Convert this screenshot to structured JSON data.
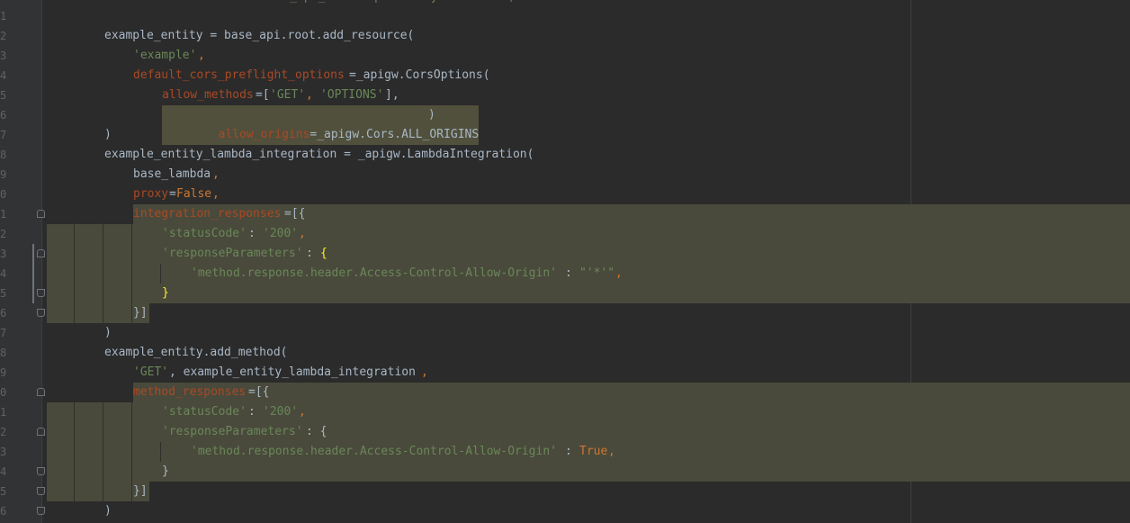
{
  "editor": {
    "top_partial_line": "      root_api_name='ApiGatewayRIServers')",
    "line_numbers": [
      "1",
      "2",
      "3",
      "4",
      "5",
      "6",
      "7",
      "8",
      "9",
      "0",
      "1",
      "2",
      "3",
      "4",
      "5",
      "6",
      "7",
      "8",
      "9",
      "0",
      "1",
      "2",
      "3",
      "4",
      "5",
      "6"
    ],
    "lines": {
      "l2_a": "example_entity = base_api.root.add_resource(",
      "l3_a": "'example'",
      "l3_b": ",",
      "l4_a": "default_cors_preflight_options",
      "l4_b": "=_apigw.CorsOptions(",
      "l5_a": "allow_methods",
      "l5_b": "=[",
      "l5_c": "'GET'",
      "l5_d": ", ",
      "l5_e": "'OPTIONS'",
      "l5_f": "],",
      "l6_a": "allow_origins",
      "l6_b": "=_apigw.Cors.ALL_ORIGINS",
      "l6_c": ")",
      "l7_a": ")",
      "l8_a": "example_entity_lambda_integration = _apigw.LambdaIntegration(",
      "l9_a": "base_lambda",
      "l9_b": ",",
      "l10_a": "proxy",
      "l10_b": "=",
      "l10_c": "False",
      "l10_d": ",",
      "l11_a": "integration_responses",
      "l11_b": "=[{",
      "l12_a": "'statusCode'",
      "l12_b": ": ",
      "l12_c": "'200'",
      "l12_d": ",",
      "l13_a": "'responseParameters'",
      "l13_b": ": ",
      "l13_c": "{",
      "l14_a": "'method.response.header.Access-Control-Allow-Origin'",
      "l14_b": ": ",
      "l14_c": "\"'*'\"",
      "l14_d": ",",
      "l15_a": "}",
      "l16_a": "}]",
      "l17_a": ")",
      "l18_a": "example_entity.add_method(",
      "l19_a": "'GET'",
      "l19_b": ", example_entity_lambda_integration",
      "l19_c": ",",
      "l20_a": "method_responses",
      "l20_b": "=[{",
      "l21_a": "'statusCode'",
      "l21_b": ": ",
      "l21_c": "'200'",
      "l21_d": ",",
      "l22_a": "'responseParameters'",
      "l22_b": ": {",
      "l23_a": "'method.response.header.Access-Control-Allow-Origin'",
      "l23_b": ": ",
      "l23_c": "True",
      "l23_d": ",",
      "l24_a": "}",
      "l25_a": "}]",
      "l26_a": ")"
    }
  },
  "colors": {
    "background": "#2b2b2b",
    "keyword": "#cc7832",
    "string": "#6a8759",
    "parameter": "#aa4926",
    "text": "#a9b7c6",
    "highlight_block": "#494a3b",
    "bracket_match": "#ffef28"
  },
  "icons": {
    "intention_bulb": "lightbulb-icon"
  }
}
